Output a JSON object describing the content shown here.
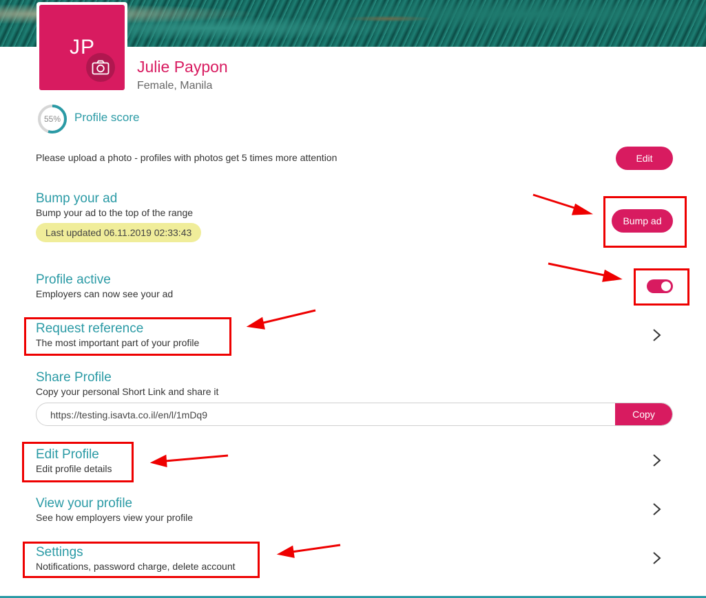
{
  "profile": {
    "initials": "JP",
    "name": "Julie Paypon",
    "meta": "Female, Manila",
    "score_percent": "55%",
    "score_value": 0.55,
    "score_label": "Profile score"
  },
  "upload": {
    "text": "Please upload a photo - profiles with photos get 5 times more attention",
    "edit_label": "Edit"
  },
  "bump": {
    "title": "Bump your ad",
    "subtitle": "Bump your ad to the top of the range",
    "last_updated": "Last updated 06.11.2019 02:33:43",
    "button_label": "Bump ad"
  },
  "active": {
    "title": "Profile active",
    "subtitle": "Employers can now see your ad",
    "toggle_on": true
  },
  "reference": {
    "title": "Request reference",
    "subtitle": "The most important part of your profile"
  },
  "share": {
    "title": "Share Profile",
    "subtitle": "Copy your personal Short Link and share it",
    "link": "https://testing.isavta.co.il/en/l/1mDq9",
    "copy_label": "Copy"
  },
  "edit_profile": {
    "title": "Edit Profile",
    "subtitle": "Edit profile details"
  },
  "view_profile": {
    "title": "View your profile",
    "subtitle": "See how employers view your profile"
  },
  "settings": {
    "title": "Settings",
    "subtitle": "Notifications, password charge, delete account"
  },
  "colors": {
    "accent": "#d81b60",
    "teal": "#2a9aa5",
    "annotation": "#ee0000",
    "highlight": "#f0ed9a"
  },
  "icons": [
    "camera-icon",
    "chevron-right-icon"
  ]
}
